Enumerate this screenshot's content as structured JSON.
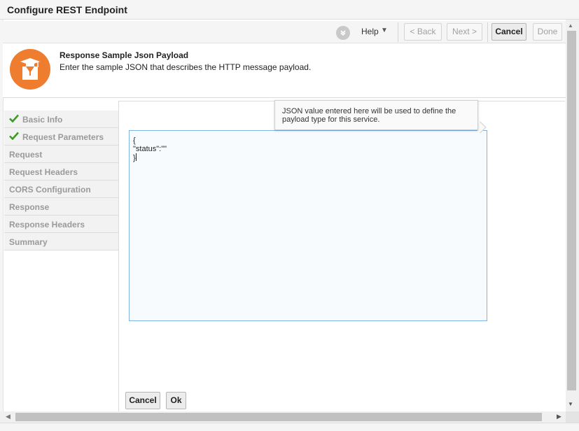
{
  "window": {
    "title": "Configure REST Endpoint"
  },
  "toolbar": {
    "help_label": "Help",
    "back_label": "< Back",
    "next_label": "Next >",
    "cancel_label": "Cancel",
    "done_label": "Done"
  },
  "header": {
    "title": "Response Sample Json Payload",
    "description": "Enter the sample JSON that describes the HTTP message payload."
  },
  "sidebar": {
    "items": [
      {
        "label": "Basic Info",
        "completed": true
      },
      {
        "label": "Request Parameters",
        "completed": true
      },
      {
        "label": "Request",
        "completed": false
      },
      {
        "label": "Request Headers",
        "completed": false
      },
      {
        "label": "CORS Configuration",
        "completed": false
      },
      {
        "label": "Response",
        "completed": false
      },
      {
        "label": "Response Headers",
        "completed": false
      },
      {
        "label": "Summary",
        "completed": false
      }
    ]
  },
  "tooltip": {
    "text": "JSON value entered here will be used to define the payload type for this service."
  },
  "editor": {
    "line1": "{",
    "line2": "\"status\":\"\"",
    "line3": "}"
  },
  "footer": {
    "cancel_label": "Cancel",
    "ok_label": "Ok"
  },
  "colors": {
    "accent": "#ee7d30",
    "check": "#3a9d23",
    "editor_border": "#7fb2e5"
  }
}
